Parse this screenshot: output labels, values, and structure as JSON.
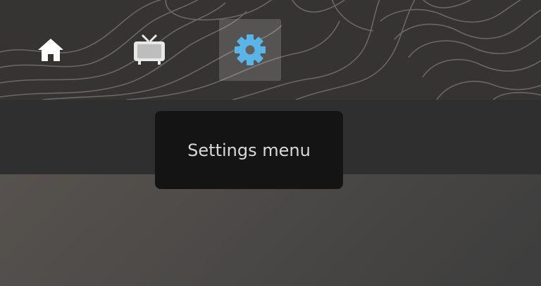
{
  "nav": {
    "items": [
      {
        "icon": "home-icon",
        "selected": false
      },
      {
        "icon": "tv-icon",
        "selected": false
      },
      {
        "icon": "gear-icon",
        "selected": true
      }
    ],
    "accent_color": "#5ab4e8"
  },
  "tooltip": {
    "text": "Settings menu"
  }
}
